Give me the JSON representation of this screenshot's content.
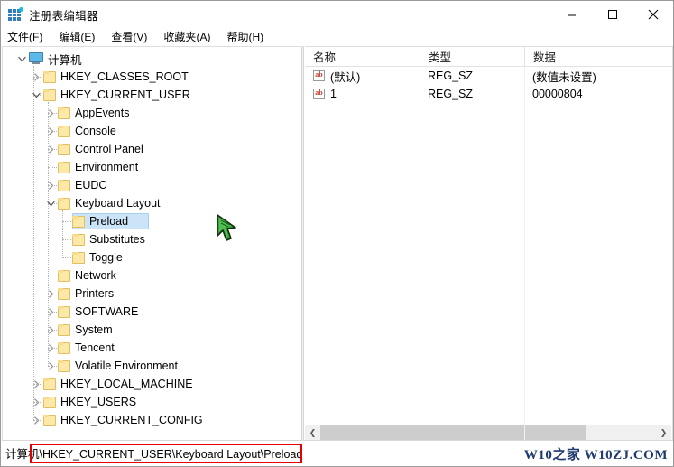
{
  "window": {
    "title": "注册表编辑器",
    "icon": "registry-editor-icon",
    "controls": {
      "minimize": "minimize-icon",
      "maximize": "maximize-icon",
      "close": "close-icon"
    }
  },
  "menubar": {
    "items": [
      {
        "label": "文件",
        "accel": "F"
      },
      {
        "label": "编辑",
        "accel": "E"
      },
      {
        "label": "查看",
        "accel": "V"
      },
      {
        "label": "收藏夹",
        "accel": "A"
      },
      {
        "label": "帮助",
        "accel": "H"
      }
    ]
  },
  "tree": {
    "items": [
      {
        "label": "计算机",
        "level": 0,
        "icon": "computer-icon",
        "expander": "expanded",
        "selected": false
      },
      {
        "label": "HKEY_CLASSES_ROOT",
        "level": 1,
        "icon": "folder-icon",
        "expander": "collapsed",
        "selected": false
      },
      {
        "label": "HKEY_CURRENT_USER",
        "level": 1,
        "icon": "folder-icon",
        "expander": "expanded",
        "selected": false
      },
      {
        "label": "AppEvents",
        "level": 2,
        "icon": "folder-icon",
        "expander": "collapsed",
        "selected": false
      },
      {
        "label": "Console",
        "level": 2,
        "icon": "folder-icon",
        "expander": "collapsed",
        "selected": false
      },
      {
        "label": "Control Panel",
        "level": 2,
        "icon": "folder-icon",
        "expander": "collapsed",
        "selected": false
      },
      {
        "label": "Environment",
        "level": 2,
        "icon": "folder-icon",
        "expander": "none",
        "selected": false
      },
      {
        "label": "EUDC",
        "level": 2,
        "icon": "folder-icon",
        "expander": "collapsed",
        "selected": false
      },
      {
        "label": "Keyboard Layout",
        "level": 2,
        "icon": "folder-icon",
        "expander": "expanded",
        "selected": false
      },
      {
        "label": "Preload",
        "level": 3,
        "icon": "folder-icon",
        "expander": "none",
        "selected": true
      },
      {
        "label": "Substitutes",
        "level": 3,
        "icon": "folder-icon",
        "expander": "none",
        "selected": false
      },
      {
        "label": "Toggle",
        "level": 3,
        "icon": "folder-icon",
        "expander": "none",
        "selected": false
      },
      {
        "label": "Network",
        "level": 2,
        "icon": "folder-icon",
        "expander": "none",
        "selected": false
      },
      {
        "label": "Printers",
        "level": 2,
        "icon": "folder-icon",
        "expander": "collapsed",
        "selected": false
      },
      {
        "label": "SOFTWARE",
        "level": 2,
        "icon": "folder-icon",
        "expander": "collapsed",
        "selected": false
      },
      {
        "label": "System",
        "level": 2,
        "icon": "folder-icon",
        "expander": "collapsed",
        "selected": false
      },
      {
        "label": "Tencent",
        "level": 2,
        "icon": "folder-icon",
        "expander": "collapsed",
        "selected": false
      },
      {
        "label": "Volatile Environment",
        "level": 2,
        "icon": "folder-icon",
        "expander": "collapsed",
        "selected": false
      },
      {
        "label": "HKEY_LOCAL_MACHINE",
        "level": 1,
        "icon": "folder-icon",
        "expander": "collapsed",
        "selected": false
      },
      {
        "label": "HKEY_USERS",
        "level": 1,
        "icon": "folder-icon",
        "expander": "collapsed",
        "selected": false
      },
      {
        "label": "HKEY_CURRENT_CONFIG",
        "level": 1,
        "icon": "folder-icon",
        "expander": "collapsed",
        "selected": false
      }
    ]
  },
  "values": {
    "columns": [
      "名称",
      "类型",
      "数据"
    ],
    "rows": [
      {
        "icon": "string-value-icon",
        "name": "(默认)",
        "type": "REG_SZ",
        "data": "(数值未设置)"
      },
      {
        "icon": "string-value-icon",
        "name": "1",
        "type": "REG_SZ",
        "data": "00000804"
      }
    ]
  },
  "scrollbar": {
    "left_arrow": "chevron-left-icon",
    "right_arrow": "chevron-right-icon"
  },
  "statusbar": {
    "path": "计算机\\HKEY_CURRENT_USER\\Keyboard Layout\\Preload"
  },
  "watermark": {
    "text": "W10之家 W10ZJ.COM"
  },
  "annotation": {
    "highlight_color": "#e60000"
  },
  "colors": {
    "selection": "#cce4f7",
    "selection_border": "#aacdeb",
    "folder_fill": "#fce9a8",
    "folder_border": "#e3bd62",
    "scrollbar_thumb": "#cdcdcd",
    "watermark": "#1f3a6e"
  }
}
